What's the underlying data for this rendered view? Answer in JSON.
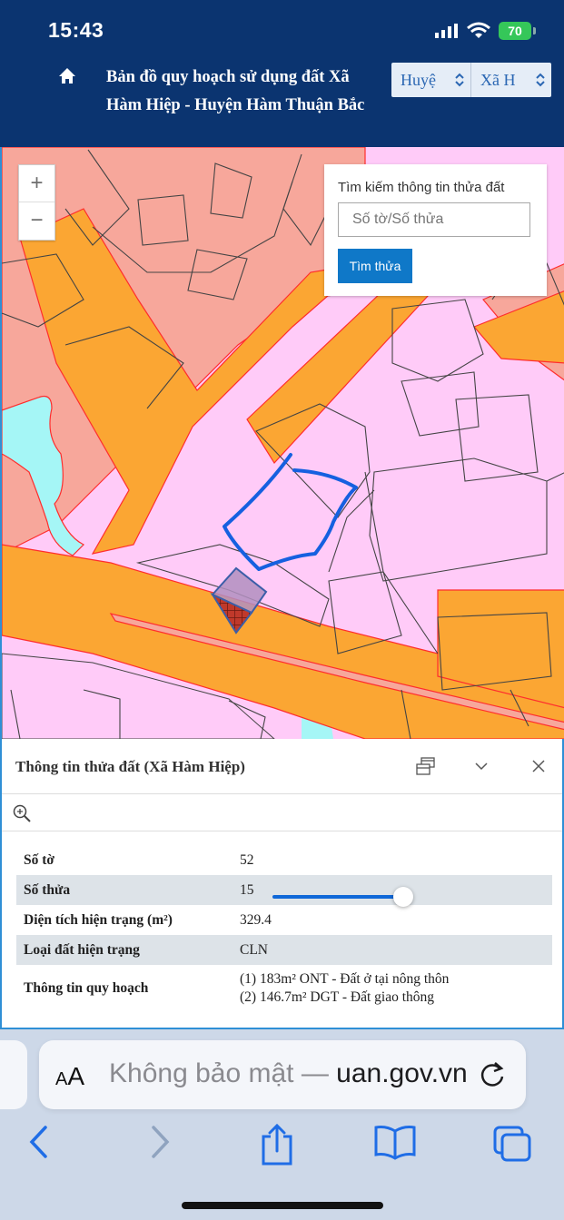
{
  "status": {
    "time": "15:43",
    "battery": "70"
  },
  "header": {
    "title": "Bản đồ quy hoạch sử dụng đất Xã Hàm Hiệp - Huyện Hàm Thuận Bắc",
    "district_select": "Huyệ",
    "commune_select": "Xã H"
  },
  "map": {
    "zoom_in": "+",
    "zoom_out": "−",
    "search": {
      "label": "Tìm kiếm thông tin thửa đất",
      "placeholder": "Số tờ/Số thửa",
      "button": "Tìm thửa"
    }
  },
  "info": {
    "title": "Thông tin thửa đất (Xã Hàm Hiệp)",
    "rows": [
      {
        "key": "Số tờ",
        "value": "52"
      },
      {
        "key": "Số thửa",
        "value": "15"
      },
      {
        "key": "Diện tích hiện trạng (m²)",
        "value": "329.4"
      },
      {
        "key": "Loại đất hiện trạng",
        "value": "CLN"
      },
      {
        "key": "Thông tin quy hoạch",
        "value_lines": [
          "(1) 183m² ONT - Đất ở tại nông thôn",
          "(2) 146.7m² DGT - Đất giao thông"
        ]
      }
    ],
    "slider_level": 0.95
  },
  "browser": {
    "aa_small": "A",
    "aa_big": "A",
    "url_prefix": "Không bảo mật — ",
    "url_domain": "uan.gov.vn"
  },
  "colors": {
    "navy": "#0b3470",
    "residential": "#f7a79b",
    "road": "#fba633",
    "other_land": "#ffcbf8",
    "water": "#a5f6f6",
    "accent_blue": "#0f78c8"
  },
  "icons": [
    "home-icon",
    "signal-icon",
    "wifi-icon",
    "chevron-updown-icon",
    "dock-icon",
    "chevron-down-icon",
    "close-icon",
    "zoom-to-icon",
    "reload-icon",
    "back-icon",
    "forward-icon",
    "share-icon",
    "bookmarks-icon",
    "tabs-icon"
  ]
}
